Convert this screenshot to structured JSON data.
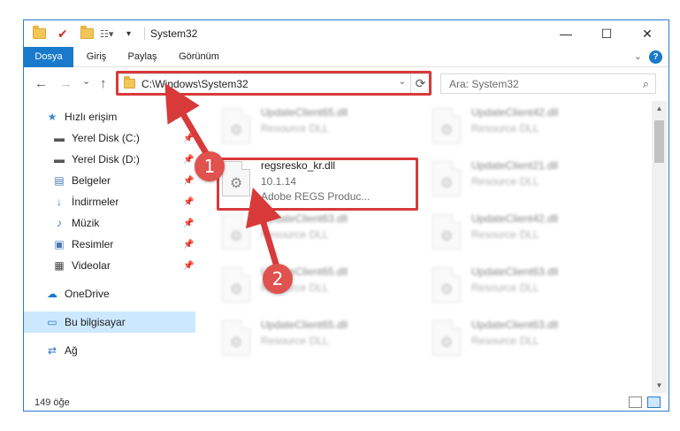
{
  "window": {
    "title": "System32",
    "controls": {
      "minimize": "—",
      "maximize": "☐",
      "close": "✕"
    }
  },
  "ribbon": {
    "tabs": [
      "Dosya",
      "Giriş",
      "Paylaş",
      "Görünüm"
    ],
    "help": "?"
  },
  "navigation": {
    "back": "←",
    "forward": "→",
    "recent": "⌄",
    "up": "↑",
    "address": "C:\\Windows\\System32",
    "refresh": "⟳",
    "search_placeholder": "Ara: System32"
  },
  "sidebar": {
    "items": [
      {
        "label": "Hızlı erişim",
        "icon": "star-icon",
        "pinned": false
      },
      {
        "label": "Yerel Disk (C:)",
        "icon": "drive-icon",
        "pinned": true
      },
      {
        "label": "Yerel Disk (D:)",
        "icon": "drive-icon",
        "pinned": true
      },
      {
        "label": "Belgeler",
        "icon": "documents-icon",
        "pinned": true
      },
      {
        "label": "İndirmeler",
        "icon": "download-icon",
        "pinned": true
      },
      {
        "label": "Müzik",
        "icon": "music-icon",
        "pinned": true
      },
      {
        "label": "Resimler",
        "icon": "pictures-icon",
        "pinned": true
      },
      {
        "label": "Videolar",
        "icon": "videos-icon",
        "pinned": true
      },
      {
        "label": "OneDrive",
        "icon": "cloud-icon",
        "pinned": false
      },
      {
        "label": "Bu bilgisayar",
        "icon": "computer-icon",
        "pinned": false,
        "selected": true
      },
      {
        "label": "Ağ",
        "icon": "network-icon",
        "pinned": false
      }
    ]
  },
  "files": {
    "left": [
      {
        "name": "UpdateClient65.dll",
        "line2": "Resource DLL",
        "line3": "",
        "blurred": true
      },
      {
        "name": "regsresko_kr.dll",
        "line2": "10.1.14",
        "line3": "Adobe REGS    Produc...",
        "blurred": false
      },
      {
        "name": "UpdateClient63.dll",
        "line2": "Resource DLL",
        "line3": "",
        "blurred": true
      },
      {
        "name": "UpdateClient65.dll",
        "line2": "Resource DLL",
        "line3": "",
        "blurred": true
      },
      {
        "name": "UpdateClient65.dll",
        "line2": "Resource DLL",
        "line3": "",
        "blurred": true
      }
    ],
    "right": [
      {
        "name": "UpdateClient42.dll",
        "line2": "Resource DLL",
        "line3": "",
        "blurred": true
      },
      {
        "name": "UpdateClient21.dll",
        "line2": "Resource DLL",
        "line3": "",
        "blurred": true
      },
      {
        "name": "UpdateClient42.dll",
        "line2": "Resource DLL",
        "line3": "",
        "blurred": true
      },
      {
        "name": "UpdateClient63.dll",
        "line2": "Resource DLL",
        "line3": "",
        "blurred": true
      },
      {
        "name": "UpdateClient63.dll",
        "line2": "Resource DLL",
        "line3": "",
        "blurred": true
      }
    ]
  },
  "status": {
    "item_count": "149 öğe"
  },
  "annotations": {
    "step1": "1",
    "step2": "2",
    "color": "#d83a3a"
  }
}
